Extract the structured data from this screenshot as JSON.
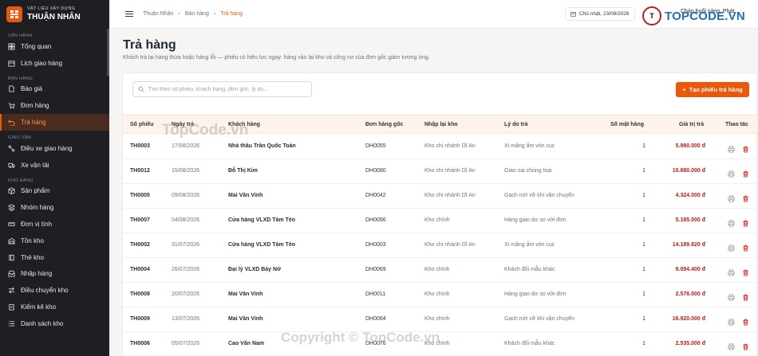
{
  "brand": {
    "sub": "VẬT LIỆU XÂY DỰNG",
    "name": "THUẬN NHÂN"
  },
  "sidebar": {
    "sections": [
      {
        "title": "VẬN HÀNH",
        "items": [
          {
            "label": "Tổng quan",
            "icon": "dashboard-icon"
          },
          {
            "label": "Lịch giao hàng",
            "icon": "calendar-icon"
          }
        ]
      },
      {
        "title": "BÁN HÀNG",
        "items": [
          {
            "label": "Báo giá",
            "icon": "document-icon"
          },
          {
            "label": "Đơn hàng",
            "icon": "cart-icon"
          },
          {
            "label": "Trả hàng",
            "icon": "return-icon",
            "active": true
          }
        ]
      },
      {
        "title": "GIAO VẬN",
        "items": [
          {
            "label": "Điều xe giao hàng",
            "icon": "route-icon"
          },
          {
            "label": "Xe vận tải",
            "icon": "truck-icon"
          }
        ]
      },
      {
        "title": "KHO HÀNG",
        "items": [
          {
            "label": "Sản phẩm",
            "icon": "box-icon"
          },
          {
            "label": "Nhóm hàng",
            "icon": "layers-icon"
          },
          {
            "label": "Đơn vị tính",
            "icon": "ruler-icon"
          },
          {
            "label": "Tồn kho",
            "icon": "warehouse-icon"
          },
          {
            "label": "Thẻ kho",
            "icon": "book-icon"
          },
          {
            "label": "Nhập hàng",
            "icon": "inbox-icon"
          },
          {
            "label": "Điều chuyển kho",
            "icon": "transfer-icon"
          },
          {
            "label": "Kiểm kê kho",
            "icon": "clipboard-icon"
          },
          {
            "label": "Danh sách kho",
            "icon": "list-icon"
          }
        ]
      }
    ]
  },
  "topbar": {
    "breadcrumb": [
      "Thuận Nhân",
      "Bán hàng",
      "Trả hàng"
    ],
    "date": "Chủ nhật, 23/08/2026",
    "greeting": "Chào buổi sáng, Phát"
  },
  "page": {
    "title": "Trả hàng",
    "subtitle": "Khách trả lại hàng thừa hoặc hàng lỗi — phiếu có hiệu lực ngay: hàng vào lại kho và công nợ của đơn gốc giảm tương ứng.",
    "search_placeholder": "Tìm theo số phiếu, khách hàng, đơn gốc, lý do...",
    "create_label": "Tạo phiếu trả hàng"
  },
  "table": {
    "columns": [
      "Số phiếu",
      "Ngày trả",
      "Khách hàng",
      "Đơn hàng gốc",
      "Nhập lại kho",
      "Lý do trả",
      "Số mặt hàng",
      "Giá trị trả",
      "Thao tác"
    ],
    "rows": [
      [
        "TH0003",
        "17/08/2026",
        "Nhà thầu Trần Quốc Toàn",
        "DH0055",
        "Kho chi nhánh Dĩ An",
        "Xi măng ẩm vón cục",
        "1",
        "5.980.000 đ"
      ],
      [
        "TH0012",
        "15/08/2026",
        "Đỗ Thị Kim",
        "DH0080",
        "Kho chi nhánh Dĩ An",
        "Giao sai chủng loại",
        "1",
        "10.680.000 đ"
      ],
      [
        "TH0005",
        "09/08/2026",
        "Mai Văn Vinh",
        "DH0042",
        "Kho chi nhánh Dĩ An",
        "Gạch nứt vỡ khi vận chuyển",
        "1",
        "4.324.000 đ"
      ],
      [
        "TH0007",
        "04/08/2026",
        "Cửa hàng VLXD Tám Tèo",
        "DH0056",
        "Kho chính",
        "Hàng giao dư so với đơn",
        "1",
        "5.185.000 đ"
      ],
      [
        "TH0002",
        "31/07/2026",
        "Cửa hàng VLXD Tám Tèo",
        "DH0003",
        "Kho chi nhánh Dĩ An",
        "Xi măng ẩm vón cục",
        "1",
        "14.189.820 đ"
      ],
      [
        "TH0004",
        "26/07/2026",
        "Đại lý VLXD Bảy Nở",
        "DH0069",
        "Kho chính",
        "Khách đổi mẫu khác",
        "1",
        "9.094.400 đ"
      ],
      [
        "TH0008",
        "20/07/2026",
        "Mai Văn Vinh",
        "DH0011",
        "Kho chính",
        "Hàng giao dư so với đơn",
        "1",
        "2.576.000 đ"
      ],
      [
        "TH0009",
        "13/07/2026",
        "Mai Văn Vinh",
        "DH0064",
        "Kho chính",
        "Gạch nứt vỡ khi vận chuyển",
        "1",
        "16.920.000 đ"
      ],
      [
        "TH0006",
        "05/07/2026",
        "Cao Văn Nam",
        "DH0076",
        "Kho chính",
        "Khách đổi mẫu khác",
        "1",
        "2.535.000 đ"
      ]
    ]
  },
  "watermarks": {
    "logo_text": "TOPCODE.VN",
    "center": "TopCode.vn",
    "copyright": "Copyright © TopCode.vn"
  },
  "colors": {
    "accent": "#ea580c",
    "amount": "#b91c1c",
    "sidebar_bg": "#1d1f23"
  }
}
